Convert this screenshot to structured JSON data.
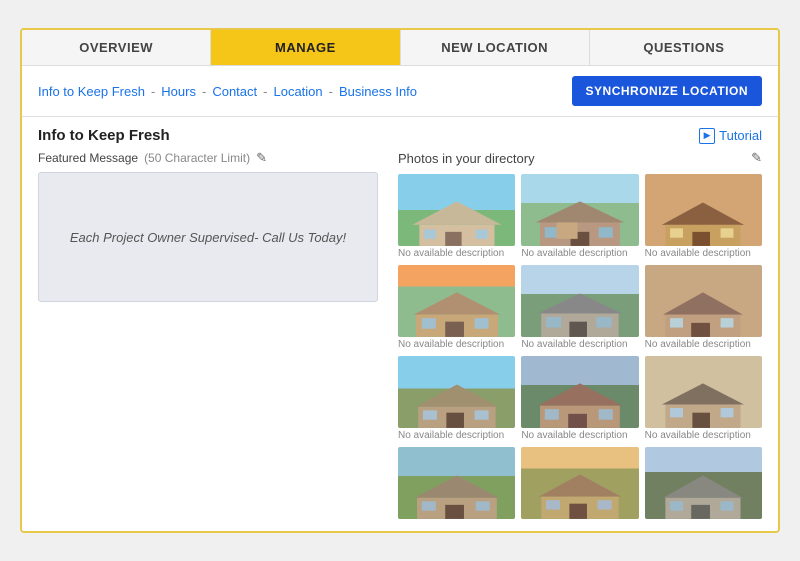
{
  "topNav": {
    "tabs": [
      {
        "label": "OVERVIEW",
        "active": false
      },
      {
        "label": "MANAGE",
        "active": true
      },
      {
        "label": "NEW LOCATION",
        "active": false
      },
      {
        "label": "QUESTIONS",
        "active": false
      }
    ]
  },
  "subNav": {
    "links": [
      {
        "label": "Info to Keep Fresh"
      },
      {
        "label": "Hours"
      },
      {
        "label": "Contact"
      },
      {
        "label": "Location"
      },
      {
        "label": "Business Info"
      }
    ],
    "syncButton": "SYNCHRONIZE LOCATION"
  },
  "sectionTitle": "Info to Keep Fresh",
  "tutorial": "Tutorial",
  "featuredMessage": {
    "label": "Featured Message",
    "limit": "(50 Character Limit)",
    "value": "Each Project Owner Supervised- Call Us Today!"
  },
  "photos": {
    "title": "Photos in your directory",
    "items": [
      {
        "desc": "No available description"
      },
      {
        "desc": "No available description"
      },
      {
        "desc": "No available description"
      },
      {
        "desc": "No available description"
      },
      {
        "desc": "No available description"
      },
      {
        "desc": "No available description"
      },
      {
        "desc": "No available description"
      },
      {
        "desc": "No available description"
      },
      {
        "desc": "No available description"
      },
      {
        "desc": ""
      },
      {
        "desc": ""
      },
      {
        "desc": ""
      }
    ]
  }
}
